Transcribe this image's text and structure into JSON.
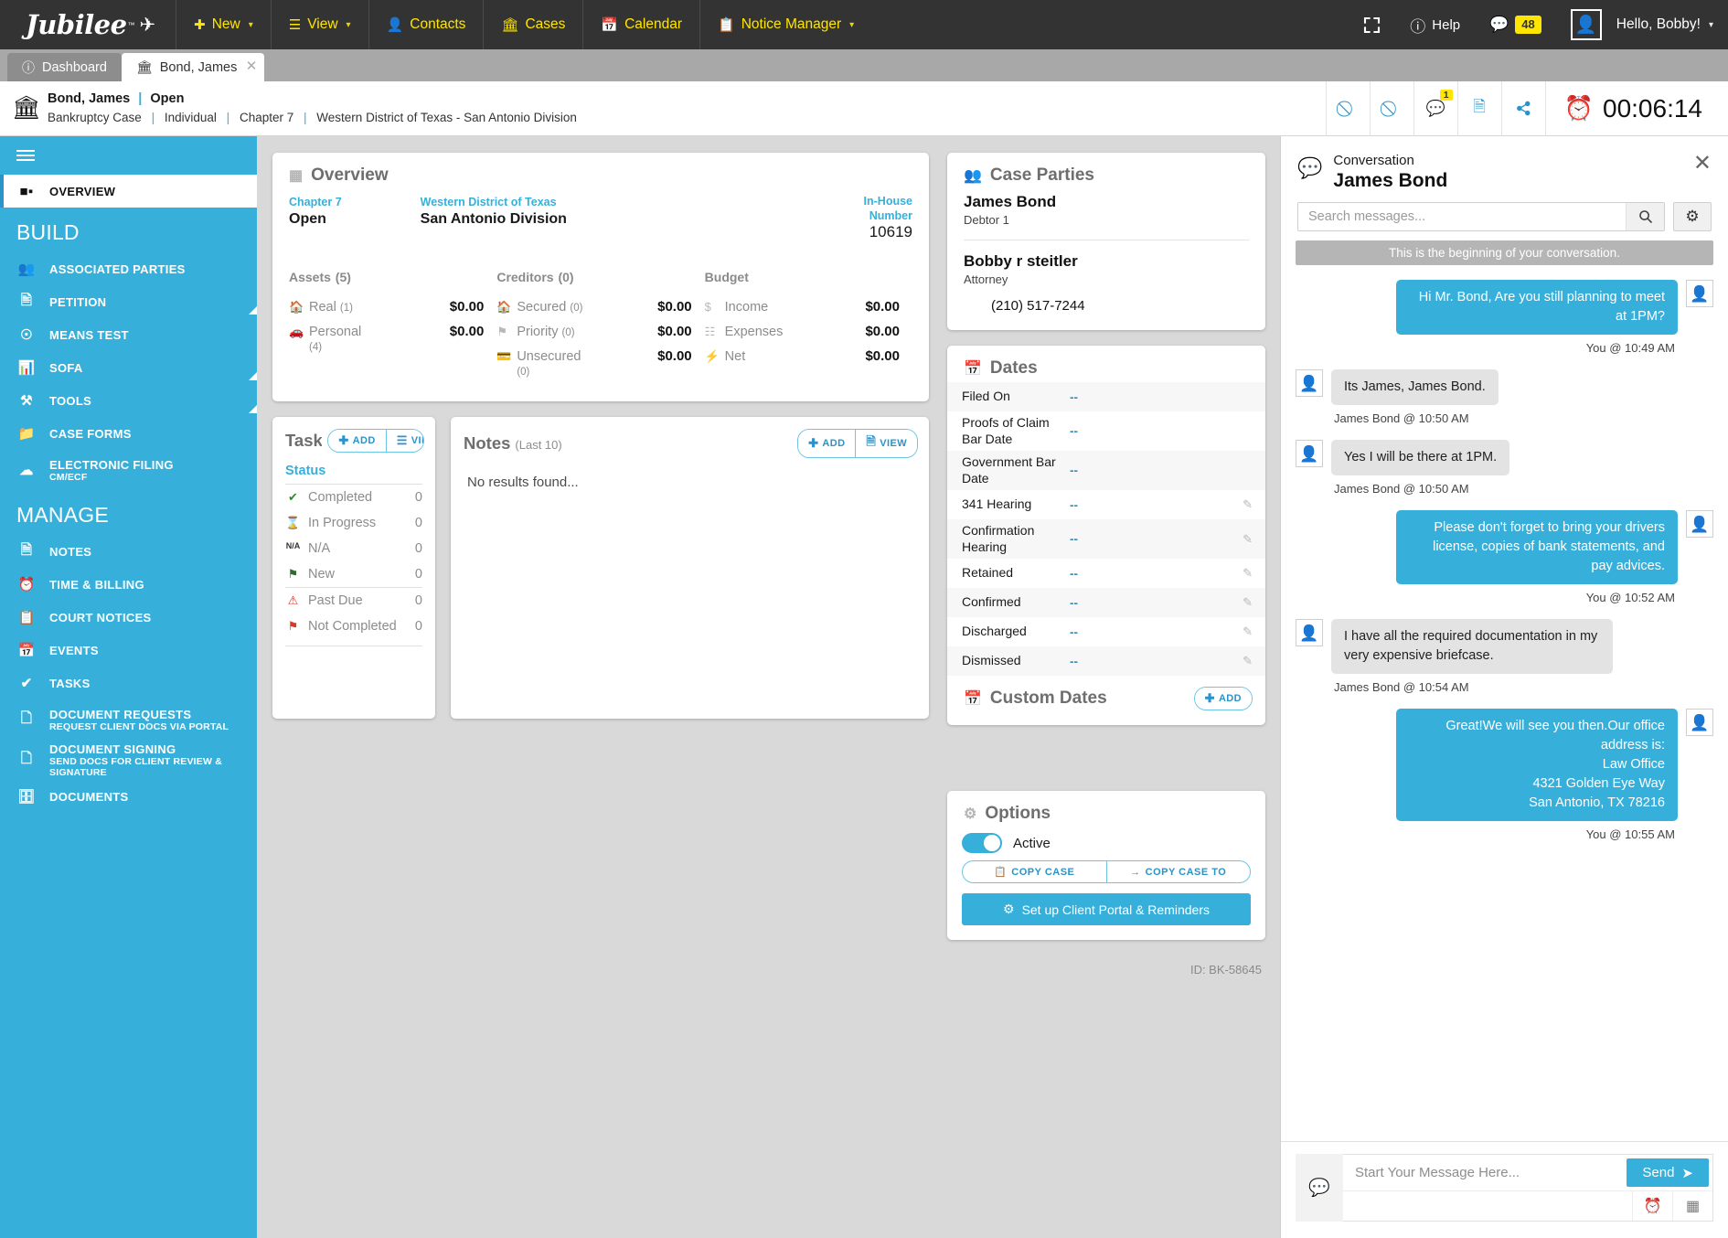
{
  "topnav": {
    "brand": "Jubilee",
    "items": [
      {
        "label": "New",
        "icon": "plus-icon",
        "caret": true
      },
      {
        "label": "View",
        "icon": "list-icon",
        "caret": true
      },
      {
        "label": "Contacts",
        "icon": "contacts-icon",
        "caret": false
      },
      {
        "label": "Cases",
        "icon": "bank-icon",
        "caret": false
      },
      {
        "label": "Calendar",
        "icon": "calendar-icon",
        "caret": false
      },
      {
        "label": "Notice Manager",
        "icon": "clipboard-icon",
        "caret": true
      }
    ],
    "right": {
      "fullscreen_icon": "expand-icon",
      "help_label": "Help",
      "messages_count": "48",
      "greeting": "Hello, Bobby!"
    }
  },
  "tabs": [
    {
      "label": "Dashboard",
      "icon": "info-icon",
      "active": false,
      "closable": false
    },
    {
      "label": "Bond, James",
      "icon": "bank-icon",
      "active": true,
      "closable": true
    }
  ],
  "case_header": {
    "name": "Bond, James",
    "status": "Open",
    "type": "Bankruptcy Case",
    "filer": "Individual",
    "chapter": "Chapter 7",
    "district": "Western District of Texas - San Antonio Division",
    "chat_badge": "1",
    "timer": "00:06:14"
  },
  "sidebar": {
    "overview_label": "OVERVIEW",
    "build_header": "BUILD",
    "manage_header": "MANAGE",
    "build_items": [
      {
        "label": "ASSOCIATED PARTIES",
        "icon": "people-icon",
        "corner": false
      },
      {
        "label": "PETITION",
        "icon": "document-icon",
        "corner": true
      },
      {
        "label": "MEANS TEST",
        "icon": "compass-icon",
        "corner": false
      },
      {
        "label": "SOFA",
        "icon": "chart-icon",
        "corner": true
      },
      {
        "label": "TOOLS",
        "icon": "tools-icon",
        "corner": true
      },
      {
        "label": "CASE FORMS",
        "icon": "folder-icon",
        "corner": false
      },
      {
        "label": "ELECTRONIC FILING",
        "sub": "CM/ECF",
        "icon": "cloud-upload-icon",
        "corner": false
      }
    ],
    "manage_items": [
      {
        "label": "NOTES",
        "icon": "note-icon"
      },
      {
        "label": "TIME & BILLING",
        "icon": "clock-icon"
      },
      {
        "label": "COURT NOTICES",
        "icon": "notice-icon"
      },
      {
        "label": "EVENTS",
        "icon": "calendar-icon"
      },
      {
        "label": "TASKS",
        "icon": "check-icon"
      },
      {
        "label": "DOCUMENT REQUESTS",
        "sub": "REQUEST CLIENT DOCS VIA PORTAL",
        "icon": "copy-doc-icon"
      },
      {
        "label": "DOCUMENT SIGNING",
        "sub": "SEND DOCS FOR CLIENT REVIEW & SIGNATURE",
        "icon": "copy-doc-icon"
      },
      {
        "label": "DOCUMENTS",
        "icon": "folder-card-icon"
      }
    ]
  },
  "overview": {
    "title": "Overview",
    "chapter_label": "Chapter 7",
    "chapter_value": "Open",
    "district_label": "Western District of Texas",
    "district_value": "San Antonio Division",
    "inhouse_label_1": "In-House",
    "inhouse_label_2": "Number",
    "inhouse_value": "10619",
    "columns": [
      {
        "heading": "Assets",
        "count": "(5)",
        "rows": [
          {
            "icon": "home-icon",
            "name": "Real",
            "sub": "(1)",
            "value": "$0.00"
          },
          {
            "icon": "car-icon",
            "name": "Personal",
            "sub": "(4)",
            "value": "$0.00"
          }
        ]
      },
      {
        "heading": "Creditors",
        "count": "(0)",
        "rows": [
          {
            "icon": "home-icon",
            "name": "Secured",
            "sub": "(0)",
            "value": "$0.00"
          },
          {
            "icon": "flag-icon",
            "name": "Priority",
            "sub": "(0)",
            "value": "$0.00"
          },
          {
            "icon": "card-icon",
            "name": "Unsecured",
            "sub": "(0)",
            "value": "$0.00"
          }
        ]
      },
      {
        "heading": "Budget",
        "count": "",
        "rows": [
          {
            "icon": "dollar-icon",
            "name": "Income",
            "sub": "",
            "value": "$0.00"
          },
          {
            "icon": "bars-icon",
            "name": "Expenses",
            "sub": "",
            "value": "$0.00"
          },
          {
            "icon": "bolt-icon",
            "name": "Net",
            "sub": "",
            "value": "$0.00"
          }
        ]
      }
    ]
  },
  "tasks": {
    "title": "Tasks",
    "add_label": "ADD",
    "view_label": "VIEW",
    "status_header": "Status",
    "rows": [
      {
        "icon": "check-icon",
        "label": "Completed",
        "count": "0",
        "color": "#2e8b2e"
      },
      {
        "icon": "hourglass-icon",
        "label": "In Progress",
        "count": "0",
        "color": "#36b0db"
      },
      {
        "icon": "na-icon",
        "label": "N/A",
        "count": "0",
        "color": "#333333"
      },
      {
        "icon": "flag-icon",
        "label": "New",
        "count": "0",
        "color": "#2e6b2e"
      },
      {
        "icon": "alert-icon",
        "label": "Past Due",
        "count": "0",
        "color": "#d8392b"
      },
      {
        "icon": "flag-icon",
        "label": "Not Completed",
        "count": "0",
        "color": "#d8392b"
      }
    ]
  },
  "notes": {
    "title": "Notes",
    "subtitle": "(Last 10)",
    "add_label": "ADD",
    "view_label": "VIEW",
    "empty": "No results found..."
  },
  "case_parties": {
    "title": "Case Parties",
    "parties": [
      {
        "name": "James Bond",
        "role": "Debtor 1",
        "phone": ""
      },
      {
        "name": "Bobby r steitler",
        "role": "Attorney",
        "phone": "(210) 517-7244"
      }
    ]
  },
  "dates": {
    "title": "Dates",
    "rows": [
      {
        "label": "Filed On",
        "value": "--",
        "editable": false
      },
      {
        "label": "Proofs of Claim Bar Date",
        "value": "--",
        "editable": false
      },
      {
        "label": "Government Bar Date",
        "value": "--",
        "editable": false
      },
      {
        "label": "341 Hearing",
        "value": "--",
        "editable": true
      },
      {
        "label": "Confirmation Hearing",
        "value": "--",
        "editable": true
      },
      {
        "label": "Retained",
        "value": "--",
        "editable": true
      },
      {
        "label": "Confirmed",
        "value": "--",
        "editable": true
      },
      {
        "label": "Discharged",
        "value": "--",
        "editable": true
      },
      {
        "label": "Dismissed",
        "value": "--",
        "editable": true
      }
    ],
    "custom_title": "Custom Dates",
    "custom_add_label": "ADD"
  },
  "options": {
    "title": "Options",
    "active_label": "Active",
    "copy_case_label": "COPY CASE",
    "copy_case_to_label": "COPY CASE TO",
    "portal_label": "Set up Client Portal & Reminders"
  },
  "case_id": "ID: BK-58645",
  "chat": {
    "subtitle": "Conversation",
    "name": "James Bond",
    "search_placeholder": "Search messages...",
    "conversation_start": "This is the beginning of your conversation.",
    "messages": [
      {
        "dir": "out",
        "text": "Hi Mr. Bond, Are you still planning to meet at 1PM?",
        "meta": "You @ 10:49 AM"
      },
      {
        "dir": "in",
        "text": "Its James, James Bond.",
        "meta": "James Bond @ 10:50 AM"
      },
      {
        "dir": "in",
        "text": "Yes I will be there at 1PM.",
        "meta": "James Bond @ 10:50 AM"
      },
      {
        "dir": "out",
        "text": "Please don't forget to bring your drivers license, copies of bank statements, and pay advices.",
        "meta": "You @ 10:52 AM"
      },
      {
        "dir": "in",
        "text": "I have all the required documentation in my very expensive briefcase.",
        "meta": "James Bond @ 10:54 AM"
      },
      {
        "dir": "out",
        "text": "Great!We will see you then.Our office address is:\nLaw Office\n4321 Golden Eye Way\nSan Antonio, TX 78216",
        "meta": "You @ 10:55 AM"
      }
    ],
    "composer_placeholder": "Start Your Message Here...",
    "send_label": "Send"
  }
}
